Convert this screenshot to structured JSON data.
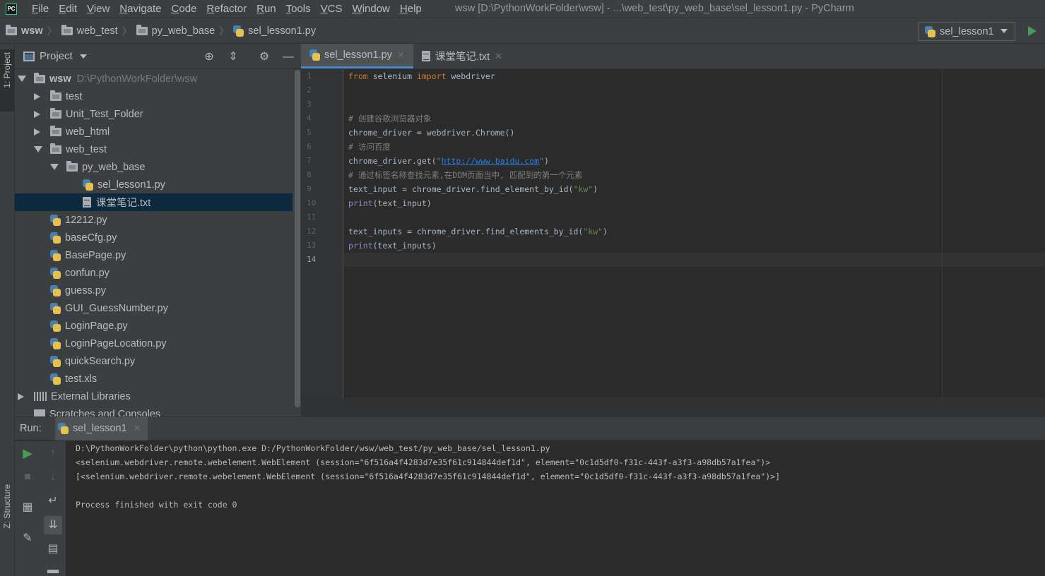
{
  "window": {
    "title": "wsw [D:\\PythonWorkFolder\\wsw] - ...\\web_test\\py_web_base\\sel_lesson1.py - PyCharm",
    "logo_text": "PC"
  },
  "menu": [
    {
      "mnemonic": "F",
      "rest": "ile"
    },
    {
      "mnemonic": "E",
      "rest": "dit"
    },
    {
      "mnemonic": "V",
      "rest": "iew"
    },
    {
      "mnemonic": "N",
      "rest": "avigate"
    },
    {
      "mnemonic": "C",
      "rest": "ode"
    },
    {
      "mnemonic": "R",
      "rest": "efactor"
    },
    {
      "mnemonic": "R",
      "rest": "un"
    },
    {
      "mnemonic": "T",
      "rest": "ools"
    },
    {
      "mnemonic": "V",
      "rest": "CS"
    },
    {
      "mnemonic": "W",
      "rest": "indow"
    },
    {
      "mnemonic": "H",
      "rest": "elp"
    }
  ],
  "breadcrumb": [
    "wsw",
    "web_test",
    "py_web_base",
    "sel_lesson1.py"
  ],
  "run_config": {
    "label": "sel_lesson1"
  },
  "left_strip": {
    "project": "1: Project",
    "structure": "Z: Structure"
  },
  "project_panel": {
    "title": "Project",
    "tree": [
      {
        "label": "wsw",
        "path": "D:\\PythonWorkFolder\\wsw",
        "level": 0,
        "arrow": "down",
        "icon": "folder-icon",
        "bold": true
      },
      {
        "label": "test",
        "level": 1,
        "arrow": "right",
        "icon": "folder-icon"
      },
      {
        "label": "Unit_Test_Folder",
        "level": 1,
        "arrow": "right",
        "icon": "folder-icon"
      },
      {
        "label": "web_html",
        "level": 1,
        "arrow": "right",
        "icon": "folder-icon"
      },
      {
        "label": "web_test",
        "level": 1,
        "arrow": "down",
        "icon": "folder-icon"
      },
      {
        "label": "py_web_base",
        "level": 2,
        "arrow": "down",
        "icon": "folder-icon"
      },
      {
        "label": "sel_lesson1.py",
        "level": 3,
        "arrow": "none",
        "icon": "python-file-icon"
      },
      {
        "label": "课堂笔记.txt",
        "level": 3,
        "arrow": "none",
        "icon": "text-file-icon",
        "selected": true
      },
      {
        "label": "12212.py",
        "level": 1,
        "arrow": "none",
        "icon": "python-file-icon"
      },
      {
        "label": "baseCfg.py",
        "level": 1,
        "arrow": "none",
        "icon": "python-file-icon"
      },
      {
        "label": "BasePage.py",
        "level": 1,
        "arrow": "none",
        "icon": "python-file-icon"
      },
      {
        "label": "confun.py",
        "level": 1,
        "arrow": "none",
        "icon": "python-file-icon"
      },
      {
        "label": "guess.py",
        "level": 1,
        "arrow": "none",
        "icon": "python-file-icon"
      },
      {
        "label": "GUI_GuessNumber.py",
        "level": 1,
        "arrow": "none",
        "icon": "python-file-icon"
      },
      {
        "label": "LoginPage.py",
        "level": 1,
        "arrow": "none",
        "icon": "python-file-icon"
      },
      {
        "label": "LoginPageLocation.py",
        "level": 1,
        "arrow": "none",
        "icon": "python-file-icon"
      },
      {
        "label": "quickSearch.py",
        "level": 1,
        "arrow": "none",
        "icon": "python-file-icon"
      },
      {
        "label": "test.xls",
        "level": 1,
        "arrow": "none",
        "icon": "python-file-icon"
      },
      {
        "label": "External Libraries",
        "level": 0,
        "arrow": "right",
        "icon": "library-icon"
      },
      {
        "label": "Scratches and Consoles",
        "level": 0,
        "arrow": "none",
        "icon": "scratch-icon"
      }
    ]
  },
  "editor": {
    "tabs": [
      {
        "label": "sel_lesson1.py",
        "icon": "python-file-icon",
        "active": true
      },
      {
        "label": "课堂笔记.txt",
        "icon": "text-file-icon",
        "active": false
      }
    ],
    "current_line": 14,
    "lines": [
      [
        {
          "t": "from",
          "c": "kw"
        },
        {
          "t": " selenium ",
          "c": ""
        },
        {
          "t": "import",
          "c": "kw"
        },
        {
          "t": " webdriver",
          "c": ""
        }
      ],
      [],
      [],
      [
        {
          "t": "# 创建谷歌浏览器对象",
          "c": "cm"
        }
      ],
      [
        {
          "t": "chrome_driver = webdriver.Chrome()",
          "c": ""
        }
      ],
      [
        {
          "t": "# 访问百度",
          "c": "cm"
        }
      ],
      [
        {
          "t": "chrome_driver.get(",
          "c": ""
        },
        {
          "t": "\"",
          "c": "str"
        },
        {
          "t": "http://www.baidu.com",
          "c": "url"
        },
        {
          "t": "\"",
          "c": "str"
        },
        {
          "t": ")",
          "c": ""
        }
      ],
      [
        {
          "t": "# 通过标签名称查找元素,在DOM页面当中, 匹配到的第一个元素",
          "c": "cm"
        }
      ],
      [
        {
          "t": "text_input = chrome_driver.find_element_by_id(",
          "c": ""
        },
        {
          "t": "\"kw\"",
          "c": "str"
        },
        {
          "t": ")",
          "c": ""
        }
      ],
      [
        {
          "t": "print",
          "c": "bi"
        },
        {
          "t": "(text_input)",
          "c": ""
        }
      ],
      [],
      [
        {
          "t": "text_inputs = chrome_driver.find_elements_by_id(",
          "c": ""
        },
        {
          "t": "\"kw\"",
          "c": "str"
        },
        {
          "t": ")",
          "c": ""
        }
      ],
      [
        {
          "t": "print",
          "c": "bi"
        },
        {
          "t": "(text_inputs)",
          "c": ""
        }
      ],
      []
    ]
  },
  "run_panel": {
    "label": "Run:",
    "tab": "sel_lesson1",
    "output": [
      "D:\\PythonWorkFolder\\python\\python.exe D:/PythonWorkFolder/wsw/web_test/py_web_base/sel_lesson1.py",
      "<selenium.webdriver.remote.webelement.WebElement (session=\"6f516a4f4283d7e35f61c914844def1d\", element=\"0c1d5df0-f31c-443f-a3f3-a98db57a1fea\")>",
      "[<selenium.webdriver.remote.webelement.WebElement (session=\"6f516a4f4283d7e35f61c914844def1d\", element=\"0c1d5df0-f31c-443f-a3f3-a98db57a1fea\")>]",
      "",
      "Process finished with exit code 0"
    ]
  },
  "colors": {
    "accent": "#4a88c7",
    "run_green": "#499c54",
    "selection": "#0d293e"
  }
}
